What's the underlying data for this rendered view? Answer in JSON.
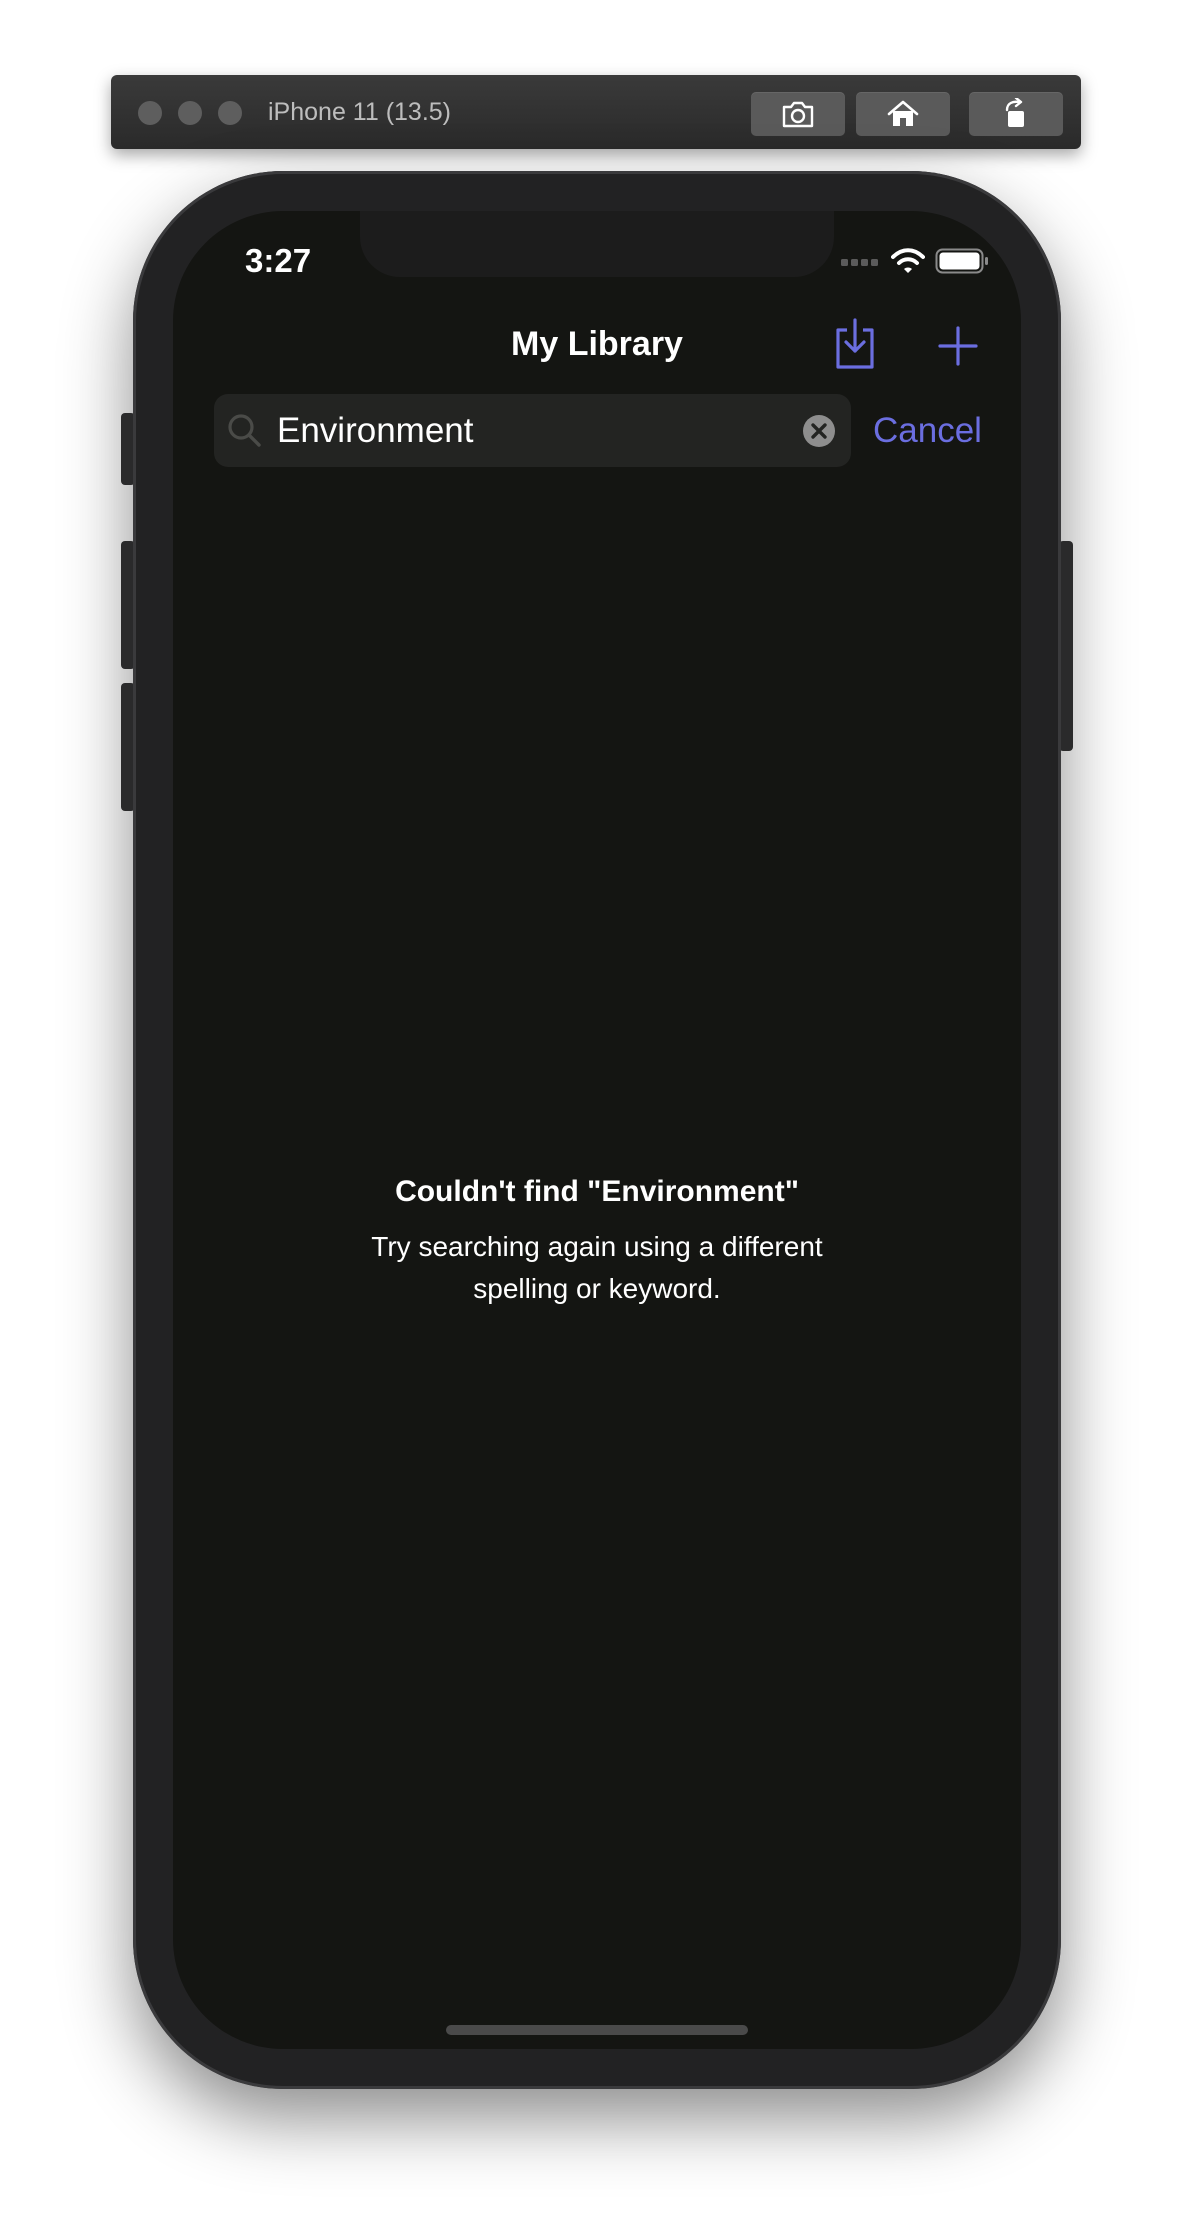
{
  "simulator": {
    "title": "iPhone 11 (13.5)",
    "buttons": [
      "screenshot-icon",
      "home-icon",
      "rotate-icon"
    ]
  },
  "status_bar": {
    "time": "3:27",
    "icons": [
      "cellular-signal-icon",
      "wifi-icon",
      "battery-icon"
    ]
  },
  "nav": {
    "title": "My Library",
    "actions": [
      "import-icon",
      "plus-icon"
    ]
  },
  "search": {
    "value": "Environment",
    "placeholder": "",
    "cancel_label": "Cancel"
  },
  "empty_state": {
    "title": "Couldn't find \"Environment\"",
    "subtitle": "Try searching again using a different spelling or keyword."
  },
  "colors": {
    "accent": "#6b6ee0",
    "screen_background": "#141512",
    "search_field": "#232422"
  }
}
